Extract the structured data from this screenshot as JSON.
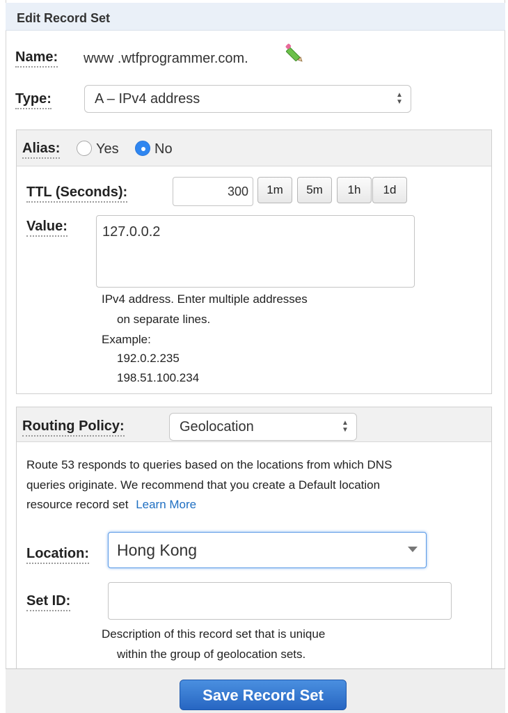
{
  "dialog": {
    "title": "Edit Record Set",
    "save_label": "Save Record Set"
  },
  "name": {
    "label": "Name:",
    "value": "www .wtfprogrammer.com.",
    "edit_icon": "pencil-icon"
  },
  "type": {
    "label": "Type:",
    "value": "A – IPv4 address"
  },
  "alias": {
    "label": "Alias:",
    "yes_label": "Yes",
    "no_label": "No",
    "selected": "No"
  },
  "ttl": {
    "label": "TTL (Seconds):",
    "value": "300",
    "buttons": [
      "1m",
      "5m",
      "1h",
      "1d"
    ]
  },
  "value": {
    "label": "Value:",
    "content": "127.0.0.2",
    "help_line1": "IPv4 address. Enter multiple addresses",
    "help_line2": "on separate lines.",
    "example_label": "Example:",
    "example_1": "192.0.2.235",
    "example_2": "198.51.100.234"
  },
  "routing": {
    "label": "Routing Policy:",
    "value": "Geolocation",
    "desc_line1": "Route 53 responds to queries based on the locations from which DNS",
    "desc_line2": "queries originate. We recommend that you create a Default location",
    "desc_line3": "resource record set",
    "learn_more": "Learn More"
  },
  "location": {
    "label": "Location:",
    "value": "Hong Kong"
  },
  "set_id": {
    "label": "Set ID:",
    "value": "",
    "help_line1": "Description of this record set that is unique",
    "help_line2": "within the group of geolocation sets."
  },
  "colors": {
    "accent": "#2f86f0",
    "link": "#1f6fc2",
    "header_bg": "#eaf0f8"
  }
}
